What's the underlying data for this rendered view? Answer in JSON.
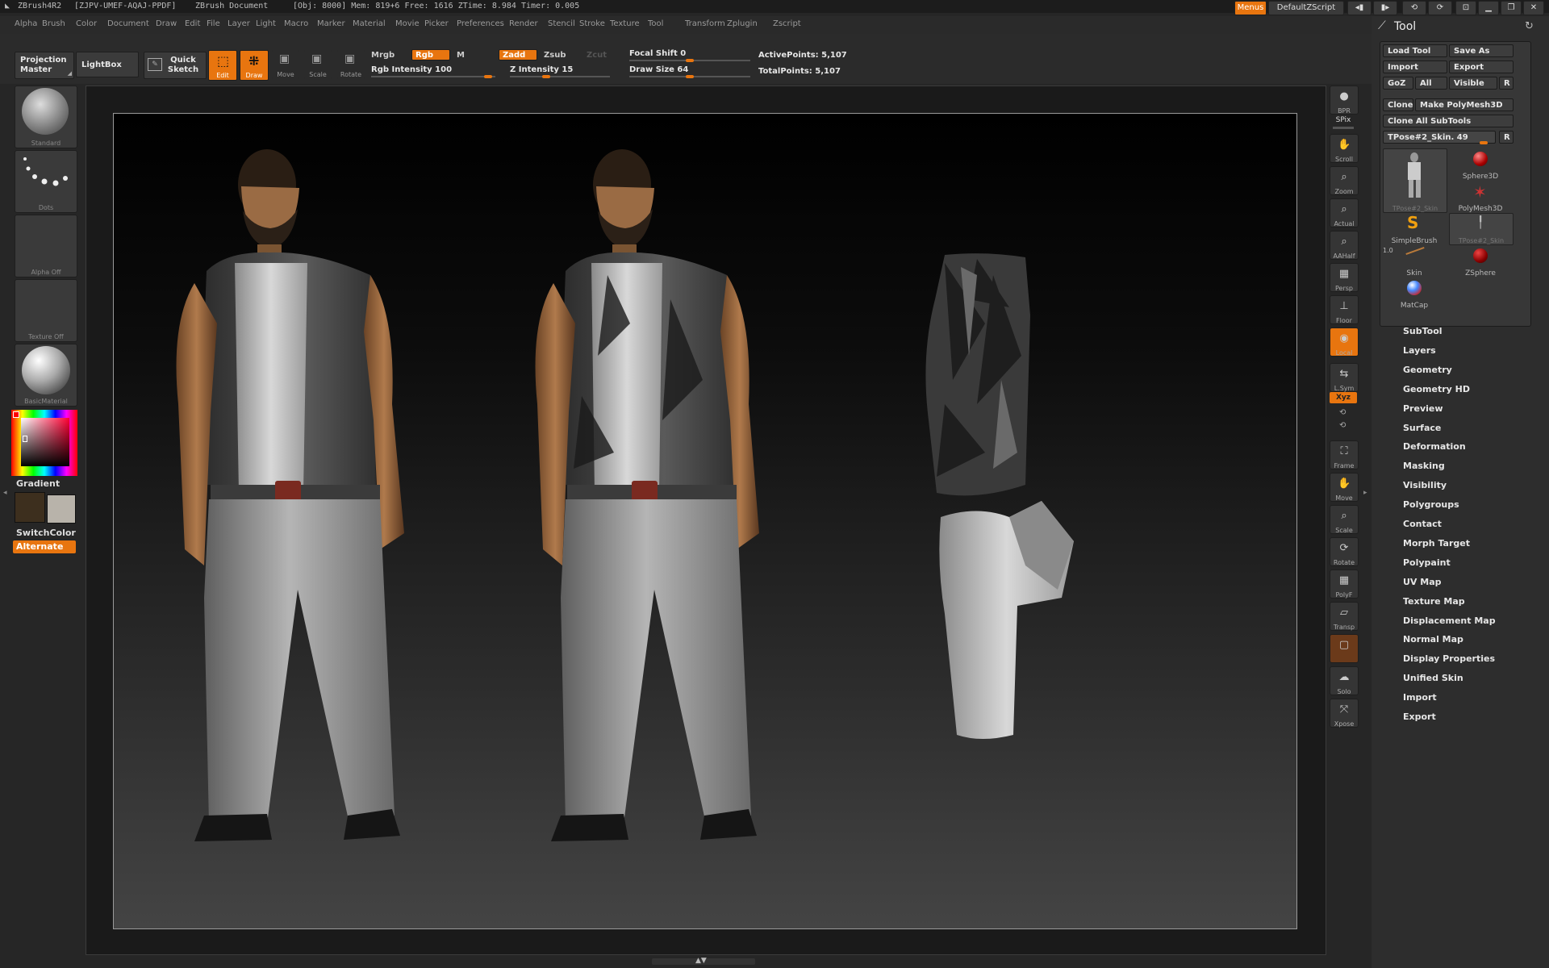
{
  "titlebar": {
    "app": "ZBrush4R2",
    "serial": "[ZJPV-UMEF-AQAJ-PPDF]",
    "document": "ZBrush Document",
    "stats": "[Obj: 8000] Mem: 819+6 Free: 1616 ZTime: 8.984 Timer: 0.005"
  },
  "menus": [
    "Alpha",
    "Brush",
    "Color",
    "Document",
    "Draw",
    "Edit",
    "File",
    "Layer",
    "Light",
    "Macro",
    "Marker",
    "Material",
    "Movie",
    "Picker",
    "Preferences",
    "Render",
    "Stencil",
    "Stroke",
    "Texture",
    "Tool",
    "Transform",
    "Zplugin",
    "Zscript"
  ],
  "topright": {
    "menus": "Menus",
    "script": "DefaultZScript"
  },
  "shelf": {
    "projection_master": "Projection Master",
    "lightbox": "LightBox",
    "quick_sketch": "Quick Sketch",
    "edit": "Edit",
    "draw": "Draw",
    "move": "Move",
    "scale": "Scale",
    "rotate": "Rotate",
    "mrgb": "Mrgb",
    "rgb": "Rgb",
    "m": "M",
    "zadd": "Zadd",
    "zsub": "Zsub",
    "zcut": "Zcut",
    "rgb_intensity": "Rgb Intensity 100",
    "z_intensity": "Z Intensity 15",
    "focal_shift": "Focal Shift 0",
    "draw_size": "Draw Size 64",
    "active_points": "ActivePoints: 5,107",
    "total_points": "TotalPoints: 5,107"
  },
  "lefttray": {
    "brush": "Standard",
    "stroke": "Dots",
    "alpha": "Alpha Off",
    "texture": "Texture Off",
    "material": "BasicMaterial",
    "gradient": "Gradient",
    "switchcolor": "SwitchColor",
    "alternate": "Alternate"
  },
  "rightshelf": [
    "BPR",
    "SPix",
    "Scroll",
    "Zoom",
    "Actual",
    "AAHalf",
    "Persp",
    "Floor",
    "Local",
    "L.Sym",
    "Xyz",
    "Frame",
    "Move",
    "Scale",
    "Rotate",
    "PolyF",
    "Transp",
    "Ghost",
    "Solo",
    "Xpose"
  ],
  "toolpanel": {
    "title": "Tool",
    "load_tool": "Load Tool",
    "save_as": "Save As",
    "import": "Import",
    "export": "Export",
    "goz": "GoZ",
    "all": "All",
    "visible": "Visible",
    "r": "R",
    "clone": "Clone",
    "make_polymesh": "Make PolyMesh3D",
    "clone_all": "Clone All SubTools",
    "current_tool": "TPose#2_Skin. 49",
    "tools": [
      {
        "name": "TPose#2_Skin",
        "icon": "figure-icon"
      },
      {
        "name": "Sphere3D",
        "icon": "sphere-icon"
      },
      {
        "name": "PolyMesh3D",
        "icon": "star-icon"
      },
      {
        "name": "SimpleBrush",
        "icon": "s-brush-icon"
      },
      {
        "name": "TPose#2_Skin",
        "icon": "figure-icon"
      },
      {
        "name": "Skin",
        "icon": "stick-icon"
      },
      {
        "name": "ZSphere",
        "icon": "zsphere-icon"
      },
      {
        "name": "MatCap",
        "icon": "matcap-icon"
      }
    ],
    "tool_badge": "1.0",
    "subpalettes": [
      "SubTool",
      "Layers",
      "Geometry",
      "Geometry HD",
      "Preview",
      "Surface",
      "Deformation",
      "Masking",
      "Visibility",
      "Polygroups",
      "Contact",
      "Morph Target",
      "Polypaint",
      "UV Map",
      "Texture Map",
      "Displacement Map",
      "Normal Map",
      "Display Properties",
      "Unified Skin",
      "Import",
      "Export"
    ]
  },
  "colors": {
    "accent": "#e8750f",
    "panel": "#2d2d2d",
    "background": "#262626"
  }
}
